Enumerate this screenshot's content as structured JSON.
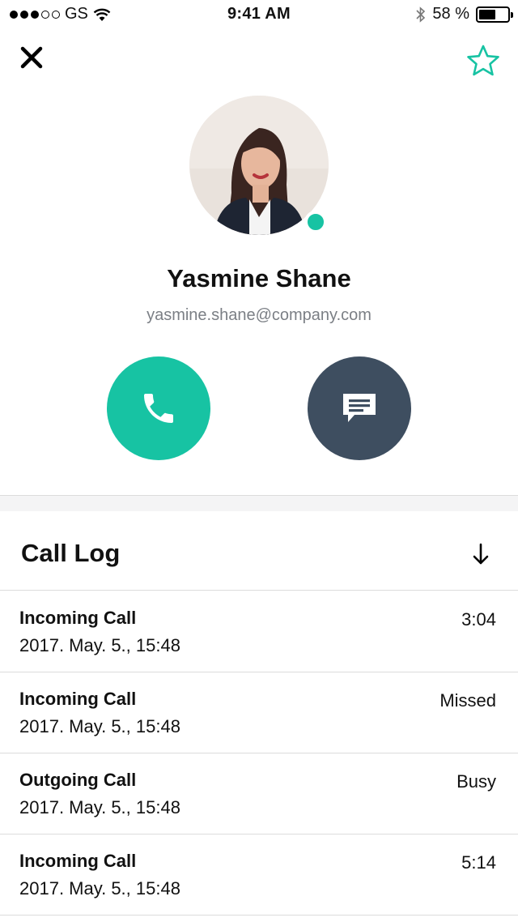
{
  "status_bar": {
    "carrier": "GS",
    "time": "9:41 AM",
    "battery": "58 %",
    "battery_level": 0.58,
    "signal_bars_filled": 3,
    "signal_bars_total": 5
  },
  "contact": {
    "name": "Yasmine Shane",
    "email": "yasmine.shane@company.com",
    "online": true
  },
  "call_log": {
    "title": "Call Log",
    "entries": [
      {
        "type": "Incoming Call",
        "date": "2017. May. 5., 15:48",
        "status": "3:04"
      },
      {
        "type": "Incoming Call",
        "date": "2017. May. 5., 15:48",
        "status": "Missed"
      },
      {
        "type": "Outgoing Call",
        "date": "2017. May. 5., 15:48",
        "status": "Busy"
      },
      {
        "type": "Incoming Call",
        "date": "2017. May. 5., 15:48",
        "status": "5:14"
      }
    ]
  },
  "colors": {
    "accent": "#17c3a3",
    "message_button": "#3e4e60",
    "secondary_text": "#7b7f85"
  },
  "icons": {
    "close": "close-icon",
    "favorite": "star-icon",
    "call": "phone-icon",
    "message": "message-icon",
    "sort": "arrow-down-icon"
  }
}
